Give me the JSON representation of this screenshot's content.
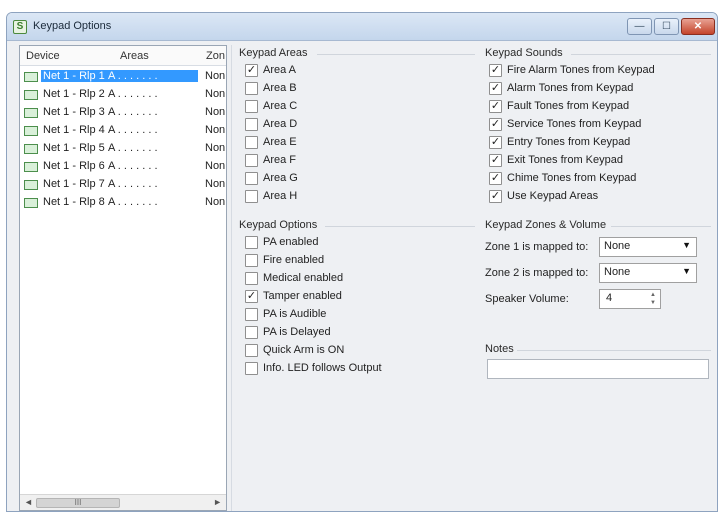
{
  "window": {
    "title": "Keypad Options",
    "app_icon": "keypad-app-icon"
  },
  "device_list": {
    "columns": [
      "Device",
      "Areas",
      "Zon"
    ],
    "rows": [
      {
        "name": "Net 1 - Rlp 1",
        "areas": "A . . . . . . .",
        "zone": "None",
        "selected": true
      },
      {
        "name": "Net 1 - Rlp 2",
        "areas": "A . . . . . . .",
        "zone": "None",
        "selected": false
      },
      {
        "name": "Net 1 - Rlp 3",
        "areas": "A . . . . . . .",
        "zone": "None",
        "selected": false
      },
      {
        "name": "Net 1 - Rlp 4",
        "areas": "A . . . . . . .",
        "zone": "None",
        "selected": false
      },
      {
        "name": "Net 1 - Rlp 5",
        "areas": "A . . . . . . .",
        "zone": "None",
        "selected": false
      },
      {
        "name": "Net 1 - Rlp 6",
        "areas": "A . . . . . . .",
        "zone": "None",
        "selected": false
      },
      {
        "name": "Net 1 - Rlp 7",
        "areas": "A . . . . . . .",
        "zone": "None",
        "selected": false
      },
      {
        "name": "Net 1 - Rlp 8",
        "areas": "A . . . . . . .",
        "zone": "None",
        "selected": false
      }
    ],
    "scroll_thumb": "III"
  },
  "keypad_areas": {
    "label": "Keypad Areas",
    "items": [
      {
        "label": "Area A",
        "checked": true
      },
      {
        "label": "Area B",
        "checked": false
      },
      {
        "label": "Area C",
        "checked": false
      },
      {
        "label": "Area D",
        "checked": false
      },
      {
        "label": "Area E",
        "checked": false
      },
      {
        "label": "Area F",
        "checked": false
      },
      {
        "label": "Area G",
        "checked": false
      },
      {
        "label": "Area H",
        "checked": false
      }
    ]
  },
  "keypad_options": {
    "label": "Keypad Options",
    "items": [
      {
        "label": "PA enabled",
        "checked": false
      },
      {
        "label": "Fire enabled",
        "checked": false
      },
      {
        "label": "Medical enabled",
        "checked": false
      },
      {
        "label": "Tamper enabled",
        "checked": true
      },
      {
        "label": "PA is Audible",
        "checked": false
      },
      {
        "label": "PA is Delayed",
        "checked": false
      },
      {
        "label": "Quick Arm is ON",
        "checked": false
      },
      {
        "label": "Info. LED follows Output",
        "checked": false
      }
    ]
  },
  "keypad_sounds": {
    "label": "Keypad Sounds",
    "items": [
      {
        "label": "Fire Alarm Tones from Keypad",
        "checked": true
      },
      {
        "label": "Alarm Tones from Keypad",
        "checked": true
      },
      {
        "label": "Fault Tones from Keypad",
        "checked": true
      },
      {
        "label": "Service Tones from Keypad",
        "checked": true
      },
      {
        "label": "Entry Tones from Keypad",
        "checked": true
      },
      {
        "label": "Exit Tones from Keypad",
        "checked": true
      },
      {
        "label": "Chime Tones from Keypad",
        "checked": true
      },
      {
        "label": "Use Keypad Areas",
        "checked": true
      }
    ]
  },
  "zones_volume": {
    "label": "Keypad Zones & Volume",
    "zone1_label": "Zone 1 is mapped to:",
    "zone1_value": "None",
    "zone2_label": "Zone 2 is mapped to:",
    "zone2_value": "None",
    "volume_label": "Speaker Volume:",
    "volume_value": "4"
  },
  "notes": {
    "label": "Notes",
    "value": ""
  },
  "glyphs": {
    "check": "✓",
    "caret": "▼",
    "spin_up": "▲",
    "spin_down": "▼",
    "min": "—",
    "max": "☐",
    "close": "✕",
    "left": "◄",
    "right": "►",
    "app": "S"
  }
}
